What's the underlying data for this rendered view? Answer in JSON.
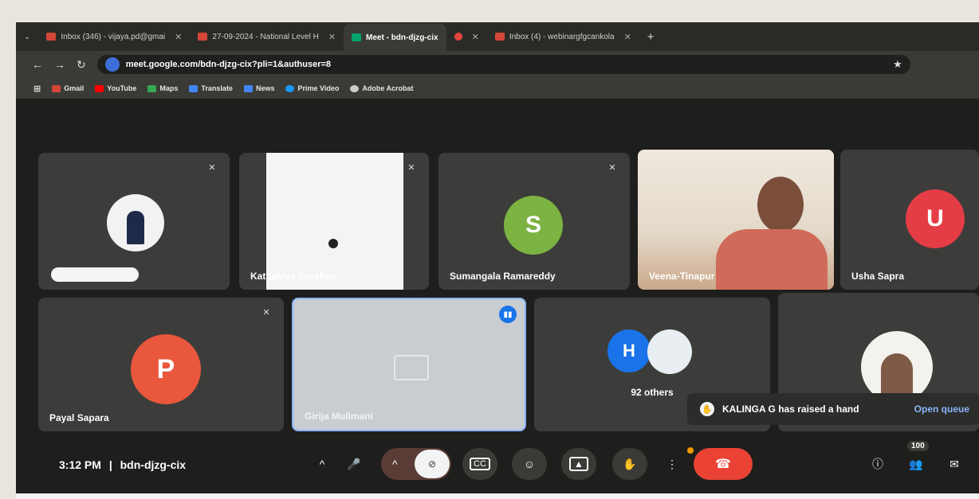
{
  "browser": {
    "tabs": [
      {
        "title": "Inbox (346) - vijaya.pd@gmai",
        "favicon_color": "#d44638",
        "active": false
      },
      {
        "title": "27-09-2024 - National Level H",
        "favicon_color": "#d44638",
        "active": false
      },
      {
        "title": "Meet - bdn-djzg-cix",
        "favicon_color": "#00a36c",
        "active": true
      },
      {
        "title": "",
        "favicon_color": "#e8463c",
        "active": false
      },
      {
        "title": "Inbox (4) - webinargfgcankola",
        "favicon_color": "#d44638",
        "active": false
      }
    ],
    "url": "meet.google.com/bdn-djzg-cix?pli=1&authuser=8",
    "bookmarks": [
      {
        "label": "Gmail",
        "color": "#d44638"
      },
      {
        "label": "YouTube",
        "color": "#ff0000"
      },
      {
        "label": "Maps",
        "color": "#34a853"
      },
      {
        "label": "Translate",
        "color": "#4285f4"
      },
      {
        "label": "News",
        "color": "#4285f4"
      },
      {
        "label": "Prime Video",
        "color": "#1a98ff"
      },
      {
        "label": "Adobe Acrobat",
        "color": "#cccccc"
      }
    ]
  },
  "participants": {
    "kathakiya": "Kathakiya Darshan",
    "sumangala": {
      "name": "Sumangala Ramareddy",
      "initial": "S",
      "color": "#7cb342"
    },
    "veena": "Veena-Tinapur",
    "usha": {
      "name": "Usha Sapra",
      "initial": "U",
      "color": "#e53d46"
    },
    "payal": {
      "name": "Payal Sapara",
      "initial": "P",
      "color": "#e9573d"
    },
    "girija": "Girija Mulimani",
    "others": {
      "initial": "H",
      "label": "92 others",
      "color": "#1a73e8"
    }
  },
  "notification": {
    "text": "KALINGA G has raised a hand",
    "action": "Open queue"
  },
  "toolbar": {
    "time": "3:12 PM",
    "separator": "|",
    "meeting_code": "bdn-djzg-cix",
    "participant_count": "100",
    "end_call_color": "#ea4335"
  }
}
